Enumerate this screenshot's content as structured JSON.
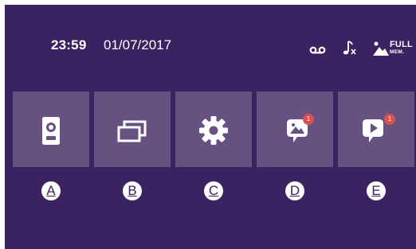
{
  "status_bar": {
    "time": "23:59",
    "date": "01/07/2017",
    "icons": [
      "voicemail-icon",
      "ringtone-mute-icon",
      "memory-full-icon"
    ],
    "memory_label": "FULL",
    "memory_sublabel": "MEM."
  },
  "menu": {
    "tiles": [
      {
        "icon": "door-station-icon",
        "letter": "A"
      },
      {
        "icon": "monitors-icon",
        "letter": "B"
      },
      {
        "icon": "settings-gear-icon",
        "letter": "C"
      },
      {
        "icon": "photo-messages-icon",
        "letter": "D",
        "badge": "1"
      },
      {
        "icon": "video-messages-icon",
        "letter": "E",
        "badge": "1"
      }
    ]
  },
  "colors": {
    "background": "#3b2361",
    "tile": "#675181",
    "badge": "#d8514e",
    "text": "#ffffff"
  }
}
